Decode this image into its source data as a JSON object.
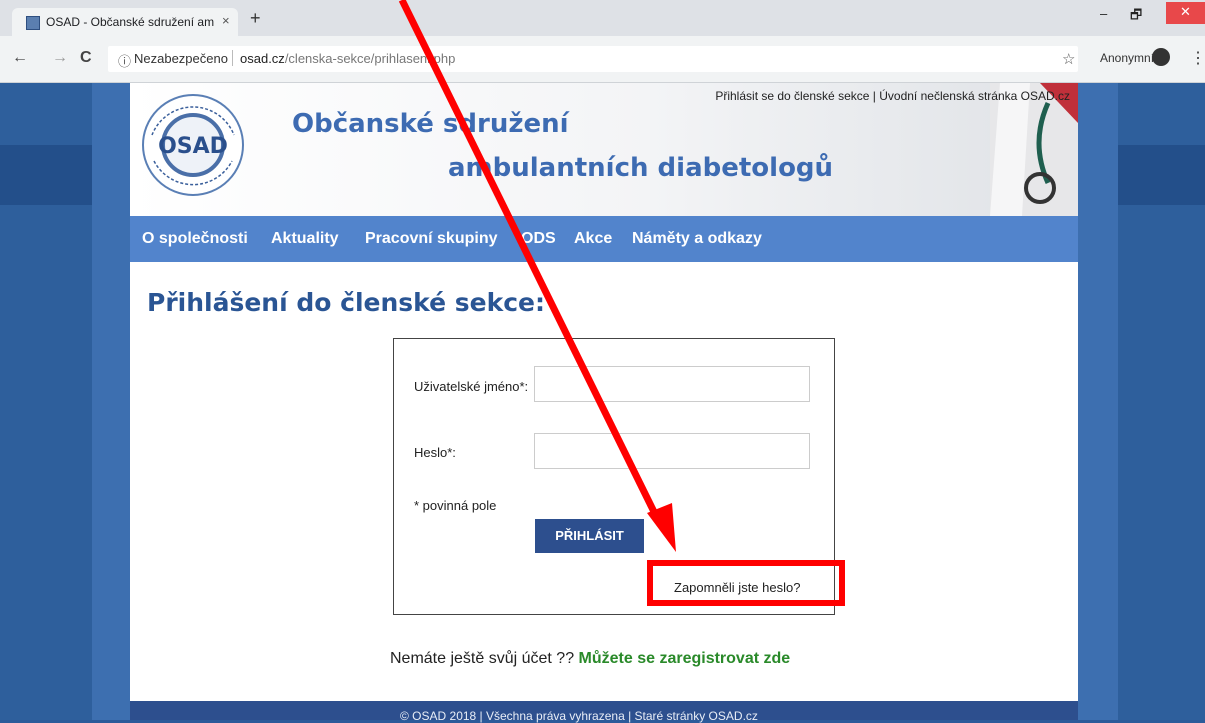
{
  "browser": {
    "tab_title": "OSAD - Občanské sdružení ambu",
    "new_tab": "+",
    "tab_close": "×",
    "security": "Nezabezpečeno",
    "url_domain": "osad.cz",
    "url_path": "/clenska-sekce/prihlaseni.php",
    "profile": "Anonymní",
    "back": "←",
    "forward": "→",
    "reload": "C",
    "info_icon": "ⓘ",
    "star": "☆",
    "menu": "⋮",
    "minimize": "–",
    "restore": "🗗",
    "close": "✕"
  },
  "header": {
    "logo_text": "OSAD",
    "title_line1": "Občanské sdružení",
    "title_line2": "ambulantních diabetologů",
    "link_login": "Přihlásit se do členské sekce",
    "link_sep": "|",
    "link_home": "Úvodní nečlenská stránka OSAD.cz"
  },
  "nav": {
    "items": [
      "O společnosti",
      "Aktuality",
      "Pracovní skupiny",
      "ODS",
      "Akce",
      "Náměty a odkazy"
    ]
  },
  "login": {
    "heading": "Přihlášení do členské sekce:",
    "username_label": "Uživatelské jméno*:",
    "username_value": "",
    "password_label": "Heslo*:",
    "password_value": "",
    "required_note": "* povinná pole",
    "submit_label": "PŘIHLÁSIT",
    "forgot_label": "Zapomněli jste heslo?"
  },
  "register": {
    "text": "Nemáte ještě svůj účet ??",
    "link": "Můžete se zaregistrovat zde"
  },
  "footer": {
    "text": "© OSAD 2018 | Všechna práva vyhrazena | Staré stránky OSAD.cz"
  },
  "annotation": {
    "color": "#ff0000"
  }
}
